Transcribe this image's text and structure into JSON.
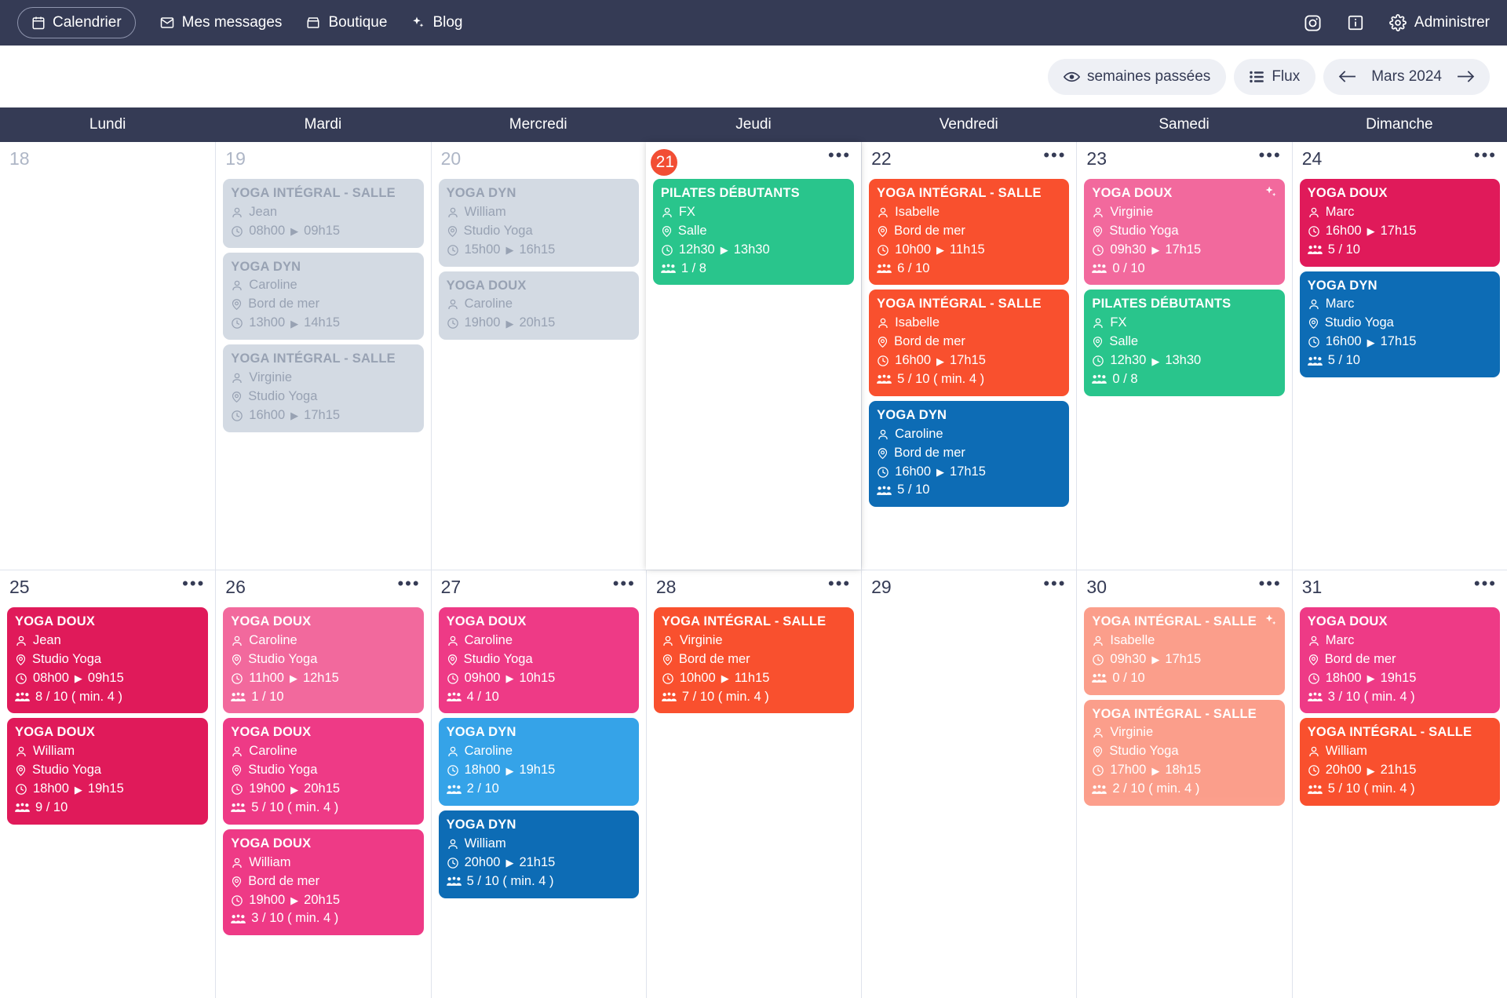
{
  "topnav": {
    "items": [
      {
        "label": "Calendrier",
        "icon": "calendar-icon",
        "active": true
      },
      {
        "label": "Mes messages",
        "icon": "envelope-icon",
        "active": false
      },
      {
        "label": "Boutique",
        "icon": "store-icon",
        "active": false
      },
      {
        "label": "Blog",
        "icon": "sparkle-icon",
        "active": false
      }
    ],
    "right": {
      "instagram": "instagram-icon",
      "info": "info-icon",
      "admin_label": "Administrer",
      "admin_icon": "gear-icon"
    }
  },
  "toolbar": {
    "past_weeks_label": "semaines passées",
    "past_weeks_icon": "eye-icon",
    "flux_label": "Flux",
    "flux_icon": "list-icon",
    "prev_icon": "arrow-left-icon",
    "month_label": "Mars 2024",
    "next_icon": "arrow-right-icon"
  },
  "day_names": [
    "Lundi",
    "Mardi",
    "Mercredi",
    "Jeudi",
    "Vendredi",
    "Samedi",
    "Dimanche"
  ],
  "colors": {
    "nav_bg": "#353B55",
    "today_badge": "#f24e34",
    "green": "#29c58c",
    "orange": "#f9502e",
    "blue_dark": "#0d6cb5",
    "blue_light": "#35a3e8",
    "pink": "#f2699d",
    "crimson": "#e01a5a",
    "pink_bright": "#ee3a86",
    "salmon_faded": "#f2947f",
    "past_bg": "#d3dae3",
    "past_text": "#98a2b3"
  },
  "weeks": [
    {
      "days": [
        {
          "num": "18",
          "muted": true,
          "today": false,
          "show_dots": false,
          "events": []
        },
        {
          "num": "19",
          "muted": true,
          "today": false,
          "show_dots": false,
          "events": [
            {
              "title": "YOGA INTÉGRAL - SALLE",
              "teacher": "Jean",
              "place": "",
              "start": "08h00",
              "end": "09h15",
              "attendance": "",
              "color": "#d3dae3",
              "past": true
            },
            {
              "title": "YOGA DYN",
              "teacher": "Caroline",
              "place": "Bord de mer",
              "start": "13h00",
              "end": "14h15",
              "attendance": "",
              "color": "#d3dae3",
              "past": true
            },
            {
              "title": "YOGA INTÉGRAL - SALLE",
              "teacher": "Virginie",
              "place": "Studio Yoga",
              "start": "16h00",
              "end": "17h15",
              "attendance": "",
              "color": "#d3dae3",
              "past": true
            }
          ]
        },
        {
          "num": "20",
          "muted": true,
          "today": false,
          "show_dots": false,
          "events": [
            {
              "title": "YOGA DYN",
              "teacher": "William",
              "place": "Studio Yoga",
              "start": "15h00",
              "end": "16h15",
              "attendance": "",
              "color": "#d3dae3",
              "past": true
            },
            {
              "title": "YOGA DOUX",
              "teacher": "Caroline",
              "place": "",
              "start": "19h00",
              "end": "20h15",
              "attendance": "",
              "color": "#d3dae3",
              "past": true
            }
          ]
        },
        {
          "num": "21",
          "muted": false,
          "today": true,
          "show_dots": true,
          "events": [
            {
              "title": "PILATES DÉBUTANTS",
              "teacher": "FX",
              "place": "Salle",
              "start": "12h30",
              "end": "13h30",
              "attendance": "1 / 8",
              "color": "#29c58c",
              "past": false
            }
          ]
        },
        {
          "num": "22",
          "muted": false,
          "today": false,
          "show_dots": true,
          "events": [
            {
              "title": "YOGA INTÉGRAL - SALLE",
              "teacher": "Isabelle",
              "place": "Bord de mer",
              "start": "10h00",
              "end": "11h15",
              "attendance": "6 / 10",
              "color": "#f9502e",
              "past": false
            },
            {
              "title": "YOGA INTÉGRAL - SALLE",
              "teacher": "Isabelle",
              "place": "Bord de mer",
              "start": "16h00",
              "end": "17h15",
              "attendance": "5 / 10 ( min. 4 )",
              "color": "#f9502e",
              "past": false
            },
            {
              "title": "YOGA DYN",
              "teacher": "Caroline",
              "place": "Bord de mer",
              "start": "16h00",
              "end": "17h15",
              "attendance": "5 / 10",
              "color": "#0d6cb5",
              "past": false
            }
          ]
        },
        {
          "num": "23",
          "muted": false,
          "today": false,
          "show_dots": true,
          "events": [
            {
              "title": "YOGA DOUX",
              "teacher": "Virginie",
              "place": "Studio Yoga",
              "start": "09h30",
              "end": "17h15",
              "attendance": "0 / 10",
              "color": "#f2699d",
              "past": false,
              "sparkle": true
            },
            {
              "title": "PILATES DÉBUTANTS",
              "teacher": "FX",
              "place": "Salle",
              "start": "12h30",
              "end": "13h30",
              "attendance": "0 / 8",
              "color": "#29c58c",
              "past": false
            }
          ]
        },
        {
          "num": "24",
          "muted": false,
          "today": false,
          "show_dots": true,
          "events": [
            {
              "title": "YOGA DOUX",
              "teacher": "Marc",
              "place": "",
              "start": "16h00",
              "end": "17h15",
              "attendance": "5 / 10",
              "color": "#e01a5a",
              "past": false
            },
            {
              "title": "YOGA DYN",
              "teacher": "Marc",
              "place": "Studio Yoga",
              "start": "16h00",
              "end": "17h15",
              "attendance": "5 / 10",
              "color": "#0d6cb5",
              "past": false
            }
          ]
        }
      ]
    },
    {
      "days": [
        {
          "num": "25",
          "muted": false,
          "today": false,
          "show_dots": true,
          "events": [
            {
              "title": "YOGA DOUX",
              "teacher": "Jean",
              "place": "Studio Yoga",
              "start": "08h00",
              "end": "09h15",
              "attendance": "8 / 10 ( min. 4 )",
              "color": "#e01a5a",
              "past": false
            },
            {
              "title": "YOGA DOUX",
              "teacher": "William",
              "place": "Studio Yoga",
              "start": "18h00",
              "end": "19h15",
              "attendance": "9 / 10",
              "color": "#e01a5a",
              "past": false
            }
          ]
        },
        {
          "num": "26",
          "muted": false,
          "today": false,
          "show_dots": true,
          "events": [
            {
              "title": "YOGA DOUX",
              "teacher": "Caroline",
              "place": "Studio Yoga",
              "start": "11h00",
              "end": "12h15",
              "attendance": "1 / 10",
              "color": "#f2699d",
              "past": false
            },
            {
              "title": "YOGA DOUX",
              "teacher": "Caroline",
              "place": "Studio Yoga",
              "start": "19h00",
              "end": "20h15",
              "attendance": "5 / 10 ( min. 4 )",
              "color": "#ee3a86",
              "past": false
            },
            {
              "title": "YOGA DOUX",
              "teacher": "William",
              "place": "Bord de mer",
              "start": "19h00",
              "end": "20h15",
              "attendance": "3 / 10 ( min. 4 )",
              "color": "#ee3a86",
              "past": false
            }
          ]
        },
        {
          "num": "27",
          "muted": false,
          "today": false,
          "show_dots": true,
          "events": [
            {
              "title": "YOGA DOUX",
              "teacher": "Caroline",
              "place": "Studio Yoga",
              "start": "09h00",
              "end": "10h15",
              "attendance": "4 / 10",
              "color": "#ee3a86",
              "past": false
            },
            {
              "title": "YOGA DYN",
              "teacher": "Caroline",
              "place": "",
              "start": "18h00",
              "end": "19h15",
              "attendance": "2 / 10",
              "color": "#35a3e8",
              "past": false
            },
            {
              "title": "YOGA DYN",
              "teacher": "William",
              "place": "",
              "start": "20h00",
              "end": "21h15",
              "attendance": "5 / 10 ( min. 4 )",
              "color": "#0d6cb5",
              "past": false
            }
          ]
        },
        {
          "num": "28",
          "muted": false,
          "today": false,
          "show_dots": true,
          "events": [
            {
              "title": "YOGA INTÉGRAL - SALLE",
              "teacher": "Virginie",
              "place": "Bord de mer",
              "start": "10h00",
              "end": "11h15",
              "attendance": "7 / 10 ( min. 4 )",
              "color": "#f9502e",
              "past": false
            }
          ]
        },
        {
          "num": "29",
          "muted": false,
          "today": false,
          "show_dots": true,
          "events": []
        },
        {
          "num": "30",
          "muted": false,
          "today": false,
          "show_dots": true,
          "events": [
            {
              "title": "YOGA INTÉGRAL - SALLE",
              "teacher": "Isabelle",
              "place": "",
              "start": "09h30",
              "end": "17h15",
              "attendance": "0 / 10",
              "color": "#f9502e",
              "past": false,
              "faded": true,
              "sparkle": true
            },
            {
              "title": "YOGA INTÉGRAL - SALLE",
              "teacher": "Virginie",
              "place": "Studio Yoga",
              "start": "17h00",
              "end": "18h15",
              "attendance": "2 / 10 ( min. 4 )",
              "color": "#f9502e",
              "past": false,
              "faded": true
            }
          ]
        },
        {
          "num": "31",
          "muted": false,
          "today": false,
          "show_dots": true,
          "events": [
            {
              "title": "YOGA DOUX",
              "teacher": "Marc",
              "place": "Bord de mer",
              "start": "18h00",
              "end": "19h15",
              "attendance": "3 / 10 ( min. 4 )",
              "color": "#ee3a86",
              "past": false
            },
            {
              "title": "YOGA INTÉGRAL - SALLE",
              "teacher": "William",
              "place": "",
              "start": "20h00",
              "end": "21h15",
              "attendance": "5 / 10 ( min. 4 )",
              "color": "#f9502e",
              "past": false
            }
          ]
        }
      ]
    }
  ]
}
